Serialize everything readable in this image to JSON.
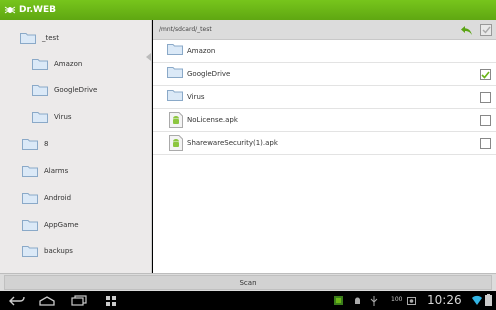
{
  "app": {
    "title": "Dr.WEB",
    "accent_color": "#6ab617"
  },
  "sidebar": {
    "items": [
      {
        "label": "_test"
      },
      {
        "label": "Amazon"
      },
      {
        "label": "GoogleDrive"
      },
      {
        "label": "Virus"
      },
      {
        "label": "8"
      },
      {
        "label": "Alarms"
      },
      {
        "label": "Android"
      },
      {
        "label": "AppGame"
      },
      {
        "label": "backups"
      }
    ]
  },
  "main": {
    "path": "/mnt/sdcard/_test",
    "files": [
      {
        "label": "Amazon",
        "icon": "folder-icon",
        "checked": false
      },
      {
        "label": "GoogleDrive",
        "icon": "folder-icon",
        "checked": true
      },
      {
        "label": "Virus",
        "icon": "folder-icon",
        "checked": false
      },
      {
        "label": "NoLicense.apk",
        "icon": "android-apk-icon",
        "checked": false
      },
      {
        "label": "SharewareSecurity(1).apk",
        "icon": "android-apk-icon",
        "checked": false
      }
    ]
  },
  "bottom": {
    "scan_label": "Scan"
  },
  "status": {
    "battery_text": "100",
    "time": "10:26"
  }
}
